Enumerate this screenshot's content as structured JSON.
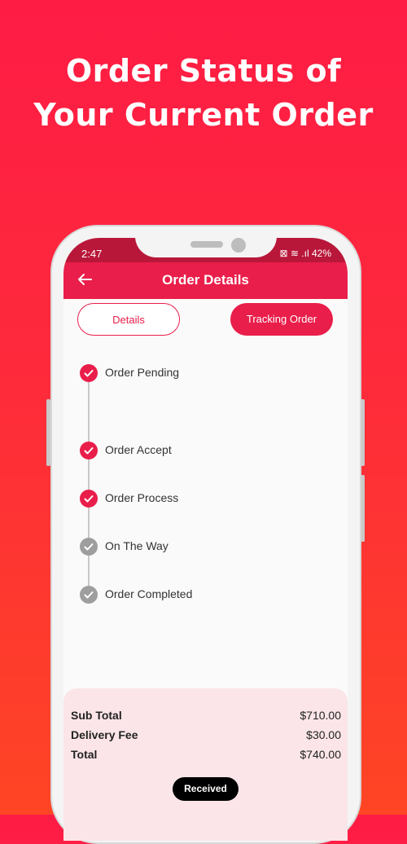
{
  "promo": {
    "line1": "Order Status of",
    "line2": "Your Current Order"
  },
  "status_bar": {
    "time": "2:47",
    "right": "⊠ ≋ .ıl 42%"
  },
  "app_bar": {
    "title": "Order Details"
  },
  "tabs": {
    "details": "Details",
    "tracking": "Tracking Order"
  },
  "steps": [
    {
      "label": "Order Pending",
      "state": "done"
    },
    {
      "label": "Order Accept",
      "state": "done"
    },
    {
      "label": "Order Process",
      "state": "done"
    },
    {
      "label": "On The Way",
      "state": "pending"
    },
    {
      "label": "Order Completed",
      "state": "pending"
    }
  ],
  "summary": {
    "subtotal_label": "Sub Total",
    "subtotal_value": "$710.00",
    "delivery_label": "Delivery Fee",
    "delivery_value": "$30.00",
    "total_label": "Total",
    "total_value": "$740.00",
    "status_button": "Received"
  },
  "colors": {
    "brand": "#e91e4a",
    "step_done": "#e91e4a",
    "step_pending": "#9e9e9e",
    "summary_bg": "#fbe5e8"
  }
}
